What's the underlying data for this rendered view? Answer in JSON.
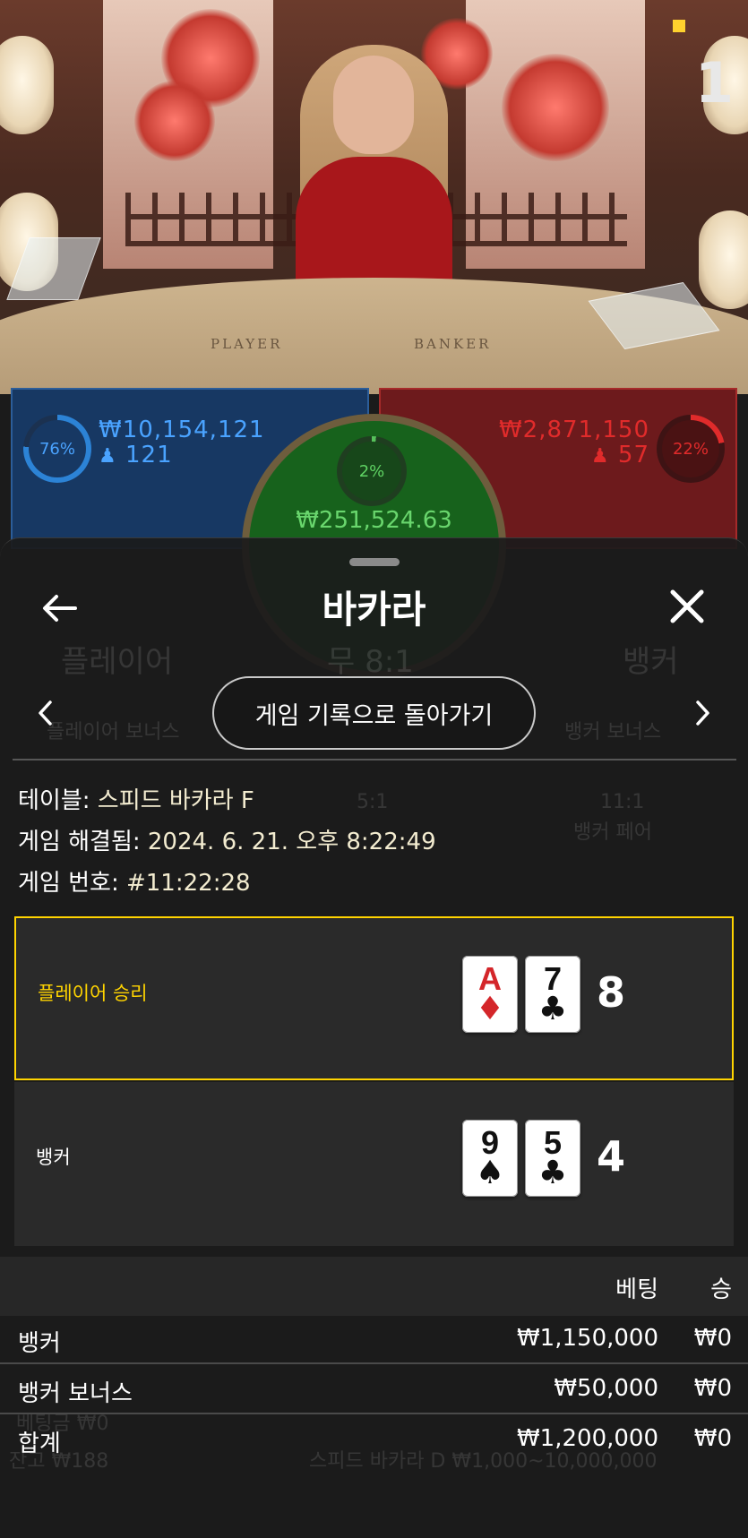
{
  "video": {
    "round_number": "1",
    "table_labels": {
      "player": "PLAYER",
      "banker": "BANKER"
    }
  },
  "bets_panel": {
    "player": {
      "percent": "76%",
      "percent_value": 76,
      "amount": "₩10,154,121",
      "players": "121",
      "color": "#2c83d6"
    },
    "tie": {
      "percent": "2%",
      "percent_value": 2,
      "amount": "₩251,524.63",
      "color": "#5fd363"
    },
    "banker": {
      "percent": "22%",
      "percent_value": 22,
      "amount": "₩2,871,150",
      "players": "57",
      "color": "#e02b2b"
    }
  },
  "background_ghost": {
    "player": "플레이어",
    "tie": "무 8:1",
    "banker": "뱅커",
    "player_bonus": "플레이어 보너스",
    "banker_bonus": "뱅커 보너스",
    "banker_pair_odds": "11:1",
    "banker_pair": "뱅커 페어",
    "either_pair_odds": "5:1",
    "balance": "잔고 ₩188",
    "bet_total": "베팅금 ₩0",
    "table_limit": "스피드 바카라 D  ₩1,000~10,000,000"
  },
  "sheet": {
    "title": "바카라",
    "back_icon": "arrow-left-icon",
    "close_icon": "close-icon",
    "prev_icon": "chevron-left-icon",
    "next_icon": "chevron-right-icon",
    "history_button": "게임 기록으로 돌아가기",
    "info": {
      "table_label": "테이블: ",
      "table_value": "스피드 바카라 F",
      "resolved_label": "게임 해결됨: ",
      "resolved_value": "2024. 6. 21. 오후 8:22:49",
      "game_no_label": "게임 번호: ",
      "game_no_value": "#11:22:28"
    },
    "results": [
      {
        "label": "플레이어 승리",
        "winner": true,
        "label_color": "#ffd400",
        "cards": [
          {
            "rank": "A",
            "suit": "♦",
            "color": "red"
          },
          {
            "rank": "7",
            "suit": "♣",
            "color": "black"
          }
        ],
        "total": "8"
      },
      {
        "label": "뱅커",
        "winner": false,
        "label_color": "#ffffff",
        "cards": [
          {
            "rank": "9",
            "suit": "♠",
            "color": "black"
          },
          {
            "rank": "5",
            "suit": "♣",
            "color": "black"
          }
        ],
        "total": "4"
      }
    ],
    "bets_table": {
      "headers": {
        "bet": "베팅",
        "win": "승"
      },
      "rows": [
        {
          "name": "뱅커",
          "bet": "₩1,150,000",
          "win": "₩0"
        },
        {
          "name": "뱅커 보너스",
          "bet": "₩50,000",
          "win": "₩0"
        },
        {
          "name": "합계",
          "bet": "₩1,200,000",
          "win": "₩0"
        }
      ]
    }
  }
}
